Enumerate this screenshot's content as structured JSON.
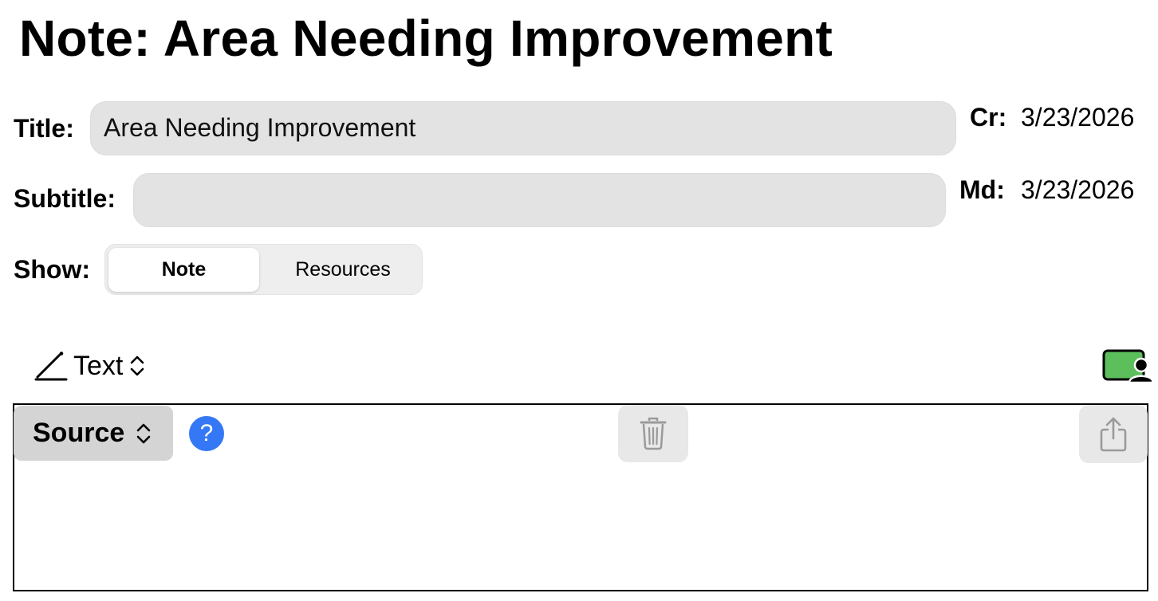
{
  "page": {
    "title": "Note: Area Needing Improvement"
  },
  "fields": {
    "title_label": "Title:",
    "title_value": "Area Needing Improvement",
    "subtitle_label": "Subtitle:",
    "subtitle_value": "",
    "show_label": "Show:"
  },
  "dates": {
    "created_label": "Cr:",
    "created_value": "3/23/2026",
    "modified_label": "Md:",
    "modified_value": "3/23/2026"
  },
  "show_segments": [
    {
      "label": "Note",
      "selected": true
    },
    {
      "label": "Resources",
      "selected": false
    }
  ],
  "editor": {
    "mode_label": "Text",
    "mode_icon": "pencil-icon",
    "source_label": "Source",
    "help_symbol": "?",
    "delete_icon": "trash-icon",
    "share_icon": "share-icon",
    "presence_icon": "screen-person-icon"
  },
  "colors": {
    "help_blue": "#3478f6",
    "presence_green": "#5cbf5c",
    "field_gray": "#e3e3e3"
  }
}
